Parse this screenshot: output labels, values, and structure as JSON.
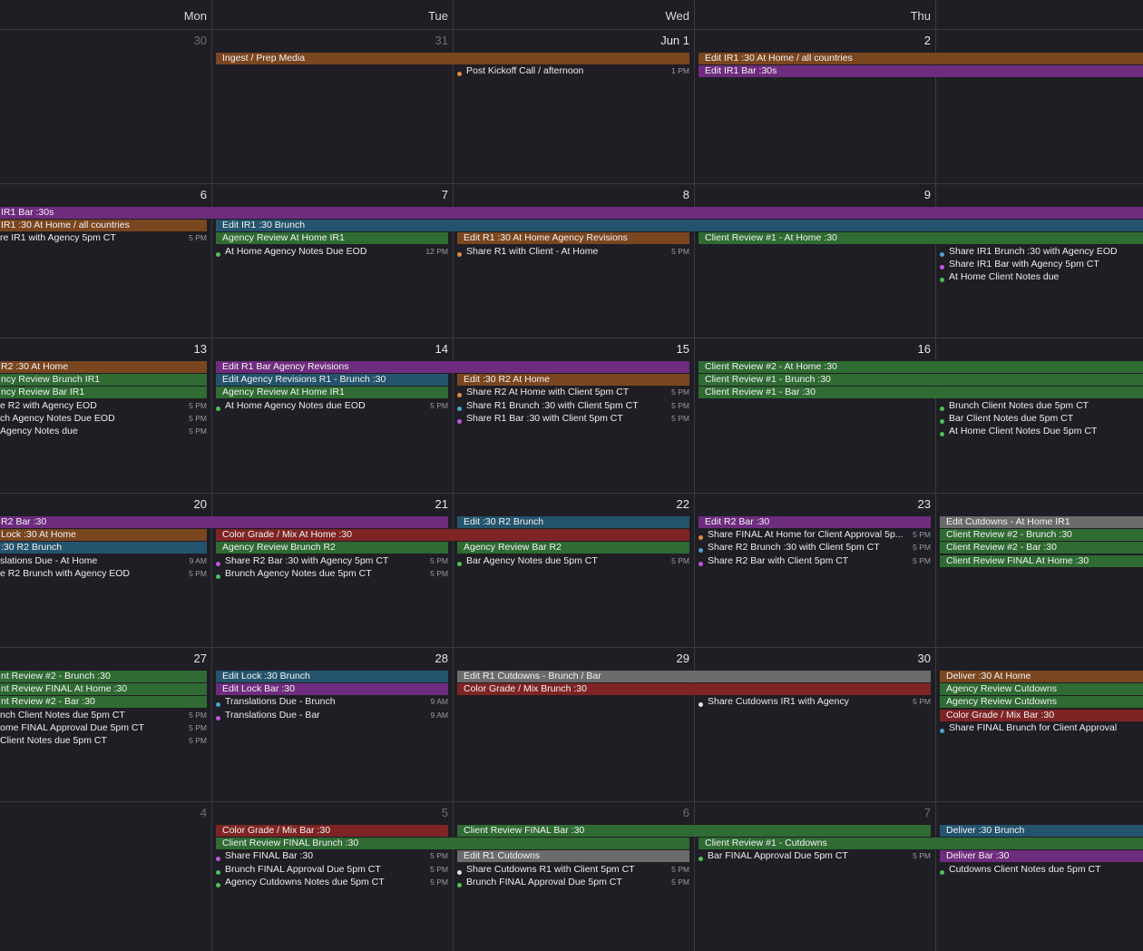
{
  "colors": {
    "brown": "#7a4620",
    "green": "#2f6b32",
    "purple": "#6e2c7e",
    "teal": "#24546d",
    "red": "#7e2424",
    "gray": "#6b6b6b",
    "dot_orange": "#e08a3c",
    "dot_green": "#4fbf5a",
    "dot_purple": "#c454e0",
    "dot_teal": "#4aa3cf",
    "dot_white": "#e6e6e6"
  },
  "weekdays": [
    "Mon",
    "Tue",
    "Wed",
    "Thu"
  ],
  "weeks": [
    {
      "days": [
        {
          "label": "30",
          "dim": true
        },
        {
          "label": "31",
          "dim": true
        },
        {
          "label": "Jun 1",
          "dim": false
        },
        {
          "label": "2",
          "dim": false
        },
        {
          "label": "",
          "dim": false
        }
      ],
      "bars": [
        {
          "text": "Ingest / Prep Media",
          "start": 1,
          "end": 3,
          "row": 0,
          "color": "brown"
        },
        {
          "text": "Edit IR1 :30 At Home / all countries",
          "start": 3,
          "end": 5,
          "row": 0,
          "color": "brown"
        },
        {
          "text": "Edit IR1 Bar :30s",
          "start": 3,
          "end": 5,
          "row": 1,
          "color": "purple"
        }
      ],
      "events": [
        {
          "text": "Post Kickoff Call / afternoon",
          "time": "1 PM",
          "col": 2,
          "row": 1,
          "dot": "dot_orange"
        }
      ]
    },
    {
      "days": [
        {
          "label": "6",
          "dim": false
        },
        {
          "label": "7",
          "dim": false
        },
        {
          "label": "8",
          "dim": false
        },
        {
          "label": "9",
          "dim": false
        },
        {
          "label": "",
          "dim": false
        }
      ],
      "bars": [
        {
          "text": "IR1 Bar :30s",
          "start": 0,
          "end": 5,
          "row": 0,
          "color": "purple"
        },
        {
          "text": "IR1 :30 At Home / all countries",
          "start": 0,
          "end": 1,
          "row": 1,
          "color": "brown"
        },
        {
          "text": "Edit IR1 :30 Brunch",
          "start": 1,
          "end": 5,
          "row": 1,
          "color": "teal"
        },
        {
          "text": "Agency Review At Home IR1",
          "start": 1,
          "end": 2,
          "row": 2,
          "color": "green"
        },
        {
          "text": "Edit R1 :30 At Home Agency Revisions",
          "start": 2,
          "end": 3,
          "row": 2,
          "color": "brown"
        },
        {
          "text": "Client Review #1 - At Home :30",
          "start": 3,
          "end": 5,
          "row": 2,
          "color": "green"
        }
      ],
      "events": [
        {
          "text": "re IR1 with Agency 5pm CT",
          "time": "5 PM",
          "col": 0,
          "row": 2,
          "dot": ""
        },
        {
          "text": "At Home Agency Notes Due EOD",
          "time": "12 PM",
          "col": 1,
          "row": 3,
          "dot": "dot_green"
        },
        {
          "text": "Share R1 with Client - At Home",
          "time": "5 PM",
          "col": 2,
          "row": 3,
          "dot": "dot_orange"
        },
        {
          "text": "Share IR1 Brunch :30 with Agency EOD",
          "time": "",
          "col": 4,
          "row": 3,
          "dot": "dot_teal"
        },
        {
          "text": "Share IR1 Bar with Agency 5pm CT",
          "time": "",
          "col": 4,
          "row": 4,
          "dot": "dot_purple"
        },
        {
          "text": "At Home Client Notes due",
          "time": "",
          "col": 4,
          "row": 5,
          "dot": "dot_green"
        }
      ]
    },
    {
      "days": [
        {
          "label": "13",
          "dim": false
        },
        {
          "label": "14",
          "dim": false
        },
        {
          "label": "15",
          "dim": false
        },
        {
          "label": "16",
          "dim": false
        },
        {
          "label": "",
          "dim": false
        }
      ],
      "bars": [
        {
          "text": "R2 :30 At Home",
          "start": 0,
          "end": 1,
          "row": 0,
          "color": "brown"
        },
        {
          "text": "Edit R1 Bar Agency Revisions",
          "start": 1,
          "end": 3,
          "row": 0,
          "color": "purple"
        },
        {
          "text": "Client Review #2 - At Home :30",
          "start": 3,
          "end": 5,
          "row": 0,
          "color": "green"
        },
        {
          "text": "ncy Review Brunch IR1",
          "start": 0,
          "end": 1,
          "row": 1,
          "color": "green"
        },
        {
          "text": "Edit Agency Revisions R1 - Brunch :30",
          "start": 1,
          "end": 2,
          "row": 1,
          "color": "teal"
        },
        {
          "text": "Edit :30 R2 At Home",
          "start": 2,
          "end": 3,
          "row": 1,
          "color": "brown"
        },
        {
          "text": "Client Review #1 - Brunch :30",
          "start": 3,
          "end": 5,
          "row": 1,
          "color": "green"
        },
        {
          "text": "ncy Review Bar IR1",
          "start": 0,
          "end": 1,
          "row": 2,
          "color": "green"
        },
        {
          "text": "Agency Review At Home IR1",
          "start": 1,
          "end": 2,
          "row": 2,
          "color": "green"
        },
        {
          "text": "Client Review #1 - Bar :30",
          "start": 3,
          "end": 5,
          "row": 2,
          "color": "green"
        }
      ],
      "events": [
        {
          "text": "Share R2 At Home with Client 5pm CT",
          "time": "5 PM",
          "col": 2,
          "row": 2,
          "dot": "dot_orange"
        },
        {
          "text": "e R2 with Agency EOD",
          "time": "5 PM",
          "col": 0,
          "row": 3,
          "dot": ""
        },
        {
          "text": "At Home Agency Notes due EOD",
          "time": "5 PM",
          "col": 1,
          "row": 3,
          "dot": "dot_green"
        },
        {
          "text": "Share R1 Brunch :30 with Client 5pm CT",
          "time": "5 PM",
          "col": 2,
          "row": 3,
          "dot": "dot_teal"
        },
        {
          "text": "Brunch Client Notes due 5pm CT",
          "time": "",
          "col": 4,
          "row": 3,
          "dot": "dot_green"
        },
        {
          "text": "ch Agency Notes Due EOD",
          "time": "5 PM",
          "col": 0,
          "row": 4,
          "dot": ""
        },
        {
          "text": "Share R1 Bar :30 with Client 5pm CT",
          "time": "5 PM",
          "col": 2,
          "row": 4,
          "dot": "dot_purple"
        },
        {
          "text": "Bar Client Notes due 5pm CT",
          "time": "",
          "col": 4,
          "row": 4,
          "dot": "dot_green"
        },
        {
          "text": "Agency Notes due",
          "time": "5 PM",
          "col": 0,
          "row": 5,
          "dot": ""
        },
        {
          "text": "At Home Client Notes Due 5pm CT",
          "time": "",
          "col": 4,
          "row": 5,
          "dot": "dot_green"
        }
      ]
    },
    {
      "days": [
        {
          "label": "20",
          "dim": false
        },
        {
          "label": "21",
          "dim": false
        },
        {
          "label": "22",
          "dim": false
        },
        {
          "label": "23",
          "dim": false
        },
        {
          "label": "",
          "dim": false
        }
      ],
      "bars": [
        {
          "text": "R2 Bar :30",
          "start": 0,
          "end": 2,
          "row": 0,
          "color": "purple"
        },
        {
          "text": "Edit :30 R2 Brunch",
          "start": 2,
          "end": 3,
          "row": 0,
          "color": "teal"
        },
        {
          "text": "Edit R2 Bar :30",
          "start": 3,
          "end": 4,
          "row": 0,
          "color": "purple"
        },
        {
          "text": "Edit Cutdowns - At Home IR1",
          "start": 4,
          "end": 5,
          "row": 0,
          "color": "gray"
        },
        {
          "text": "Lock :30 At Home",
          "start": 0,
          "end": 1,
          "row": 1,
          "color": "brown"
        },
        {
          "text": "Color Grade / Mix At Home :30",
          "start": 1,
          "end": 3,
          "row": 1,
          "color": "red"
        },
        {
          "text": "Client Review #2 - Brunch :30",
          "start": 4,
          "end": 5,
          "row": 1,
          "color": "green"
        },
        {
          "text": ":30 R2 Brunch",
          "start": 0,
          "end": 1,
          "row": 2,
          "color": "teal"
        },
        {
          "text": "Agency Review Brunch R2",
          "start": 1,
          "end": 2,
          "row": 2,
          "color": "green"
        },
        {
          "text": "Agency Review Bar R2",
          "start": 2,
          "end": 3,
          "row": 2,
          "color": "green"
        },
        {
          "text": "Client Review #2 - Bar :30",
          "start": 4,
          "end": 5,
          "row": 2,
          "color": "green"
        },
        {
          "text": "Client Review FINAL At Home :30",
          "start": 4,
          "end": 5,
          "row": 3,
          "color": "green"
        }
      ],
      "events": [
        {
          "text": "Share FINAL At Home for Client Approval 5p...",
          "time": "5 PM",
          "col": 3,
          "row": 1,
          "dot": "dot_orange"
        },
        {
          "text": "Share R2 Brunch :30 with Client 5pm CT",
          "time": "5 PM",
          "col": 3,
          "row": 2,
          "dot": "dot_teal"
        },
        {
          "text": "slations Due - At Home",
          "time": "9 AM",
          "col": 0,
          "row": 3,
          "dot": ""
        },
        {
          "text": "Share R2 Bar :30 with Agency 5pm CT",
          "time": "5 PM",
          "col": 1,
          "row": 3,
          "dot": "dot_purple"
        },
        {
          "text": "Bar Agency Notes due 5pm CT",
          "time": "5 PM",
          "col": 2,
          "row": 3,
          "dot": "dot_green"
        },
        {
          "text": "Share R2 Bar with Client 5pm CT",
          "time": "5 PM",
          "col": 3,
          "row": 3,
          "dot": "dot_purple"
        },
        {
          "text": "e R2 Brunch with Agency EOD",
          "time": "5 PM",
          "col": 0,
          "row": 4,
          "dot": ""
        },
        {
          "text": "Brunch Agency Notes due 5pm CT",
          "time": "5 PM",
          "col": 1,
          "row": 4,
          "dot": "dot_green"
        }
      ]
    },
    {
      "days": [
        {
          "label": "27",
          "dim": false
        },
        {
          "label": "28",
          "dim": false
        },
        {
          "label": "29",
          "dim": false
        },
        {
          "label": "30",
          "dim": false
        },
        {
          "label": "",
          "dim": false
        }
      ],
      "bars": [
        {
          "text": "nt Review #2 - Brunch :30",
          "start": 0,
          "end": 1,
          "row": 0,
          "color": "green"
        },
        {
          "text": "Edit Lock :30  Brunch",
          "start": 1,
          "end": 2,
          "row": 0,
          "color": "teal"
        },
        {
          "text": "Edit R1 Cutdowns - Brunch / Bar",
          "start": 2,
          "end": 4,
          "row": 0,
          "color": "gray"
        },
        {
          "text": "Deliver :30 At Home",
          "start": 4,
          "end": 5,
          "row": 0,
          "color": "brown"
        },
        {
          "text": "nt Review FINAL At Home :30",
          "start": 0,
          "end": 1,
          "row": 1,
          "color": "green"
        },
        {
          "text": "Edit Lock Bar :30",
          "start": 1,
          "end": 2,
          "row": 1,
          "color": "purple"
        },
        {
          "text": "Color Grade / Mix Brunch :30",
          "start": 2,
          "end": 4,
          "row": 1,
          "color": "red"
        },
        {
          "text": "Agency Review Cutdowns",
          "start": 4,
          "end": 5,
          "row": 1,
          "color": "green"
        },
        {
          "text": "nt Review #2 - Bar :30",
          "start": 0,
          "end": 1,
          "row": 2,
          "color": "green"
        },
        {
          "text": "Agency Review Cutdowns",
          "start": 4,
          "end": 5,
          "row": 2,
          "color": "green"
        },
        {
          "text": "Color Grade / Mix Bar :30",
          "start": 4,
          "end": 5,
          "row": 3,
          "color": "red"
        }
      ],
      "events": [
        {
          "text": "Translations Due - Brunch",
          "time": "9 AM",
          "col": 1,
          "row": 2,
          "dot": "dot_teal"
        },
        {
          "text": "Share Cutdowns IR1 with Agency",
          "time": "5 PM",
          "col": 3,
          "row": 2,
          "dot": "dot_white"
        },
        {
          "text": "nch Client Notes due 5pm CT",
          "time": "5 PM",
          "col": 0,
          "row": 3,
          "dot": ""
        },
        {
          "text": "Translations Due - Bar",
          "time": "9 AM",
          "col": 1,
          "row": 3,
          "dot": "dot_purple"
        },
        {
          "text": "ome FINAL Approval Due 5pm CT",
          "time": "5 PM",
          "col": 0,
          "row": 4,
          "dot": ""
        },
        {
          "text": "Share FINAL Brunch for Client Approval",
          "time": "",
          "col": 4,
          "row": 4,
          "dot": "dot_teal"
        },
        {
          "text": "Client Notes due 5pm CT",
          "time": "5 PM",
          "col": 0,
          "row": 5,
          "dot": ""
        }
      ]
    },
    {
      "days": [
        {
          "label": "4",
          "dim": true
        },
        {
          "label": "5",
          "dim": true
        },
        {
          "label": "6",
          "dim": true
        },
        {
          "label": "7",
          "dim": true
        },
        {
          "label": "",
          "dim": false
        }
      ],
      "bars": [
        {
          "text": "Color Grade / Mix Bar :30",
          "start": 1,
          "end": 2,
          "row": 0,
          "color": "red"
        },
        {
          "text": "Client Review FINAL Bar :30",
          "start": 2,
          "end": 4,
          "row": 0,
          "color": "green"
        },
        {
          "text": "Deliver :30 Brunch",
          "start": 4,
          "end": 5,
          "row": 0,
          "color": "teal"
        },
        {
          "text": "Client Review FINAL Brunch :30",
          "start": 1,
          "end": 3,
          "row": 1,
          "color": "green"
        },
        {
          "text": "Client Review #1 - Cutdowns",
          "start": 3,
          "end": 5,
          "row": 1,
          "color": "green"
        },
        {
          "text": "Edit R1 Cutdowns",
          "start": 2,
          "end": 3,
          "row": 2,
          "color": "gray"
        },
        {
          "text": "Deliver Bar :30",
          "start": 4,
          "end": 5,
          "row": 2,
          "color": "purple"
        }
      ],
      "events": [
        {
          "text": "Share FINAL Bar :30",
          "time": "5 PM",
          "col": 1,
          "row": 2,
          "dot": "dot_purple"
        },
        {
          "text": "Bar FINAL Approval Due 5pm CT",
          "time": "5 PM",
          "col": 3,
          "row": 2,
          "dot": "dot_green"
        },
        {
          "text": "Brunch FINAL Approval Due 5pm CT",
          "time": "5 PM",
          "col": 1,
          "row": 3,
          "dot": "dot_green"
        },
        {
          "text": "Share Cutdowns R1 with Client 5pm CT",
          "time": "5 PM",
          "col": 2,
          "row": 3,
          "dot": "dot_white"
        },
        {
          "text": "Cutdowns Client Notes due 5pm CT",
          "time": "",
          "col": 4,
          "row": 3,
          "dot": "dot_green"
        },
        {
          "text": "Agency Cutdowns Notes due 5pm CT",
          "time": "5 PM",
          "col": 1,
          "row": 4,
          "dot": "dot_green"
        },
        {
          "text": "Brunch FINAL Approval Due 5pm CT",
          "time": "5 PM",
          "col": 2,
          "row": 4,
          "dot": "dot_green"
        }
      ]
    }
  ]
}
